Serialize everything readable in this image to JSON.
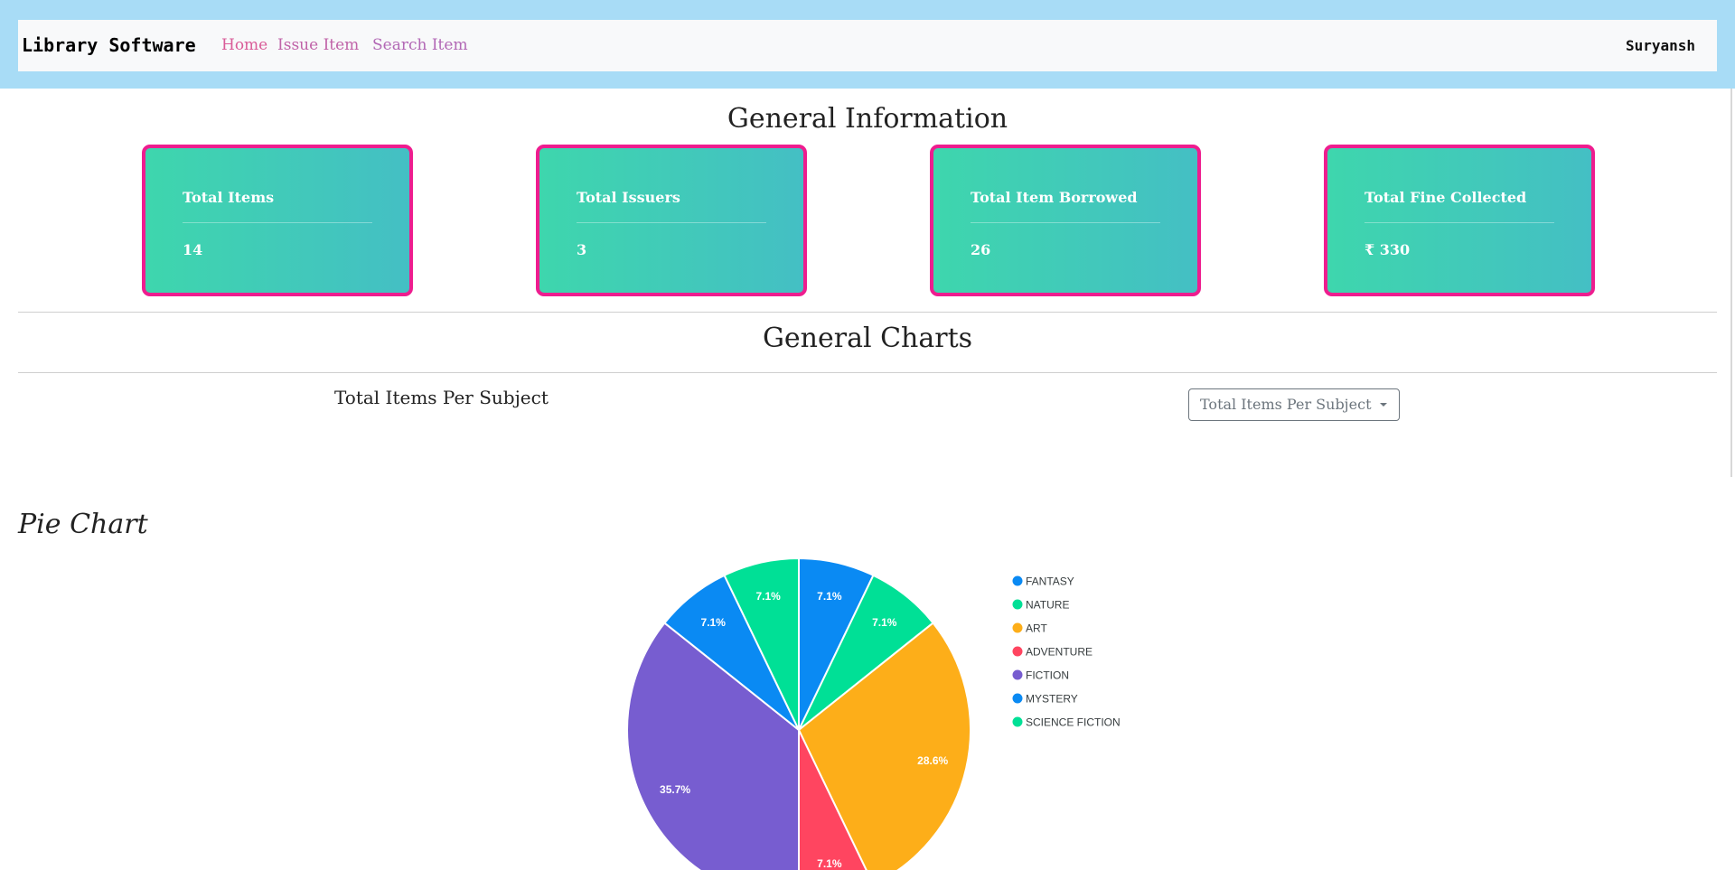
{
  "navbar": {
    "brand": "Library Software",
    "links": [
      "Home",
      "Issue Item",
      "Search Item"
    ],
    "user": "Suryansh",
    "colors": {
      "band": "#a8dcf6",
      "bar": "#f8f9fa",
      "link_home": "#d95c98",
      "link_issue": "#c063a8",
      "link_search": "#b268b5"
    }
  },
  "general_info": {
    "title": "General Information",
    "cards": [
      {
        "label": "Total Items",
        "value": "14"
      },
      {
        "label": "Total Issuers",
        "value": "3"
      },
      {
        "label": "Total Item Borrowed",
        "value": "26"
      },
      {
        "label": "Total Fine Collected",
        "value": "₹ 330"
      }
    ],
    "card_colors": {
      "border": "#ee1d8f",
      "gradient_start": "#3ed6ad",
      "gradient_end": "#44bfc4"
    }
  },
  "general_charts": {
    "title": "General Charts",
    "subtitle": "Total Items Per Subject",
    "dropdown_selected": "Total Items Per Subject",
    "chart_heading": "Pie Chart"
  },
  "chart_data": {
    "type": "pie",
    "title": "Pie Chart",
    "categories": [
      "FANTASY",
      "NATURE",
      "ART",
      "ADVENTURE",
      "FICTION",
      "MYSTERY",
      "SCIENCE FICTION"
    ],
    "values": [
      1,
      1,
      4,
      1,
      5,
      1,
      1
    ],
    "labels": [
      "7.1%",
      "7.1%",
      "28.6%",
      "7.1%",
      "35.7%",
      "7.1%",
      "7.1%"
    ],
    "colors": [
      "#0a8af3",
      "#00e096",
      "#fdae19",
      "#ff4560",
      "#775dd0",
      "#0a8af3",
      "#00e096"
    ],
    "legend_position": "right"
  }
}
